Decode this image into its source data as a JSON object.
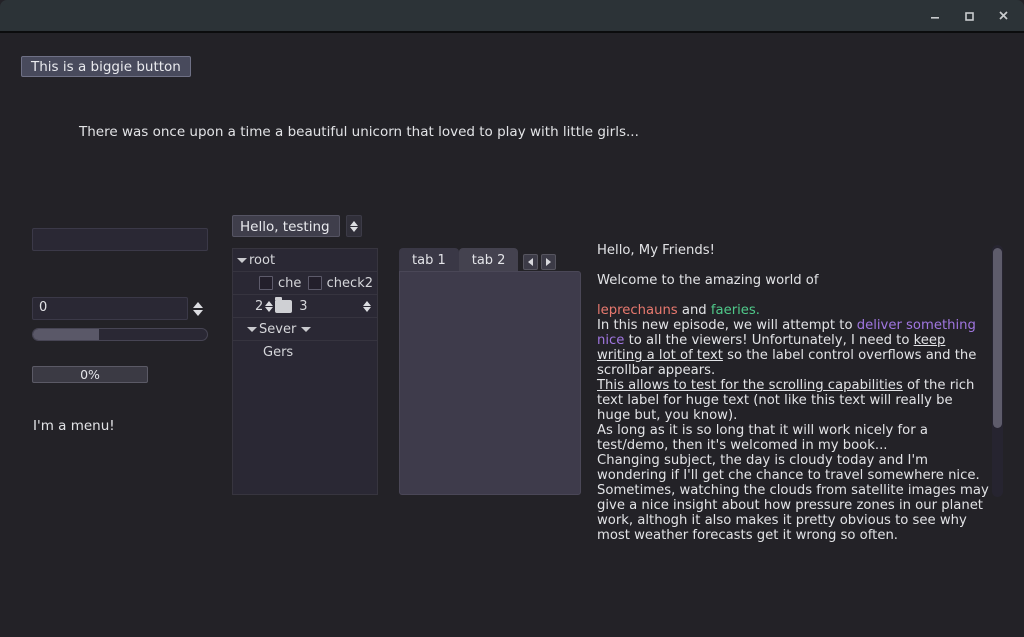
{
  "window": {
    "titlebar_controls": [
      {
        "name": "minimize",
        "glyph": "minimize-icon"
      },
      {
        "name": "maximize",
        "glyph": "maximize-icon"
      },
      {
        "name": "close",
        "glyph": "close-icon"
      }
    ]
  },
  "buttons": {
    "biggie_label": "This is a biggie button"
  },
  "labels": {
    "unicorn": "There was once upon a time a beautiful unicorn that loved to play with little girls...",
    "menu": "I'm a menu!"
  },
  "inputs": {
    "line_edit_value": "",
    "line_edit_placeholder": "",
    "spinbox_value": "0"
  },
  "slider": {
    "value": 38,
    "min": 0,
    "max": 100
  },
  "progress": {
    "label": "0%",
    "value": 0
  },
  "combo": {
    "selected": "Hello, testing",
    "options": [
      "Hello, testing"
    ]
  },
  "tree": {
    "rows": [
      {
        "kind": "root",
        "label": "root"
      },
      {
        "kind": "checks",
        "check1": "che",
        "check2": "check2"
      },
      {
        "kind": "spinfolder",
        "left_value": "2",
        "right_value": "3"
      },
      {
        "kind": "branch",
        "label": "Sever"
      },
      {
        "kind": "leaf",
        "label": "Gers"
      }
    ]
  },
  "tabs": {
    "items": [
      {
        "label": "tab 1",
        "selected": true
      },
      {
        "label": "tab 2",
        "selected": false
      }
    ],
    "nav_prev": "prev-tab",
    "nav_next": "next-tab"
  },
  "richtext": {
    "heading": "Hello, My Friends!",
    "welcome": "Welcome to the amazing world of",
    "creature_a": "leprechauns",
    "and": " and ",
    "creature_b": "faeries.",
    "line_ep_1": "In this new episode, we will attempt to ",
    "deliver": "deliver something nice",
    "line_ep_2": " to all the viewers! Unfortunately, I need to ",
    "keep_writing": "keep writing a lot of text",
    "line_ep_3": " so the label control overflows and the scrollbar appears.",
    "scroll_u": "This allows to test for the scrolling capabilities",
    "scroll_rest": " of the rich text label for huge text (not like this text will really be huge but, you know).",
    "aslong": "As long as it is so long that it will work nicely for a test/demo, then it's welcomed in my book...",
    "changing": "Changing subject, the day is cloudy today and I'm wondering if I'll get che chance to travel somewhere nice. Sometimes, watching the clouds from satellite images may give a nice insight about how pressure zones in our planet work, althogh it also makes it pretty obvious to see why most weather forecasts get it wrong so often."
  },
  "colors": {
    "window_bg": "#232227",
    "titlebar_bg": "#2c3337",
    "accent_button": "#484a5c",
    "creature_a": "#e8796f",
    "creature_b": "#4fc98a",
    "deliver": "#a076e0",
    "tab_panel": "#3e3b4b",
    "tree_bg": "#2a2834"
  },
  "scrollbar": {
    "thumb_position_pct": 0,
    "thumb_size_pct": 73
  }
}
